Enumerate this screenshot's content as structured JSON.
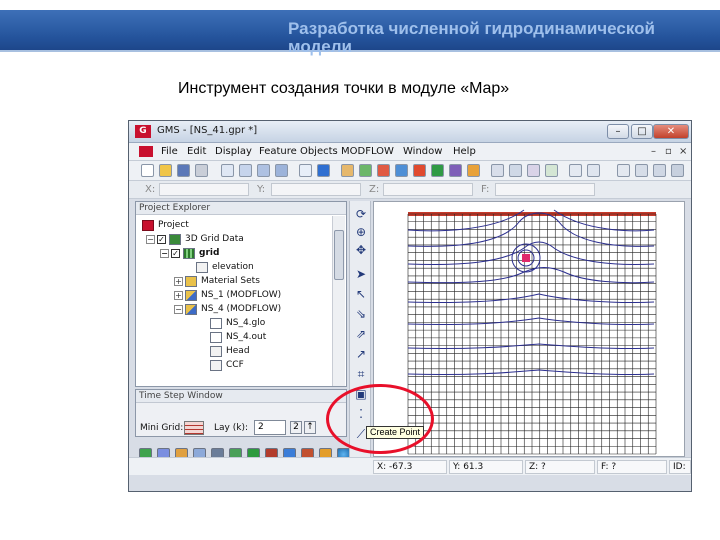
{
  "slide": {
    "title": "Разработка численной гидродинамической модели",
    "subtitle": "Инструмент создания точки в модуле «Map»"
  },
  "window": {
    "title": "GMS - [NS_41.gpr *]",
    "controls": {
      "minimize": "–",
      "maximize": "□",
      "close": "✕"
    }
  },
  "menu": {
    "items": [
      "File",
      "Edit",
      "Display",
      "Feature Objects",
      "MODFLOW",
      "Window",
      "Help"
    ],
    "mdi_controls": {
      "minimize": "–",
      "restore": "▫",
      "close": "×"
    }
  },
  "coords_top": {
    "x_label": "X:",
    "y_label": "Y:",
    "z_label": "Z:",
    "f_label": "F:"
  },
  "explorer": {
    "title": "Project Explorer",
    "tree": [
      {
        "label": "Project",
        "icon": "project-icon"
      },
      {
        "label": "3D Grid Data",
        "icon": "grid-folder-icon",
        "expander": "−",
        "checked": true
      },
      {
        "label": "grid",
        "icon": "grid-icon",
        "expander": "−",
        "checked": true
      },
      {
        "label": "elevation",
        "icon": "dataset-icon"
      },
      {
        "label": "Material Sets",
        "icon": "folder-icon",
        "expander": "+"
      },
      {
        "label": "NS_1 (MODFLOW)",
        "icon": "modflow-icon",
        "expander": "+"
      },
      {
        "label": "NS_4 (MODFLOW)",
        "icon": "modflow-icon",
        "expander": "−"
      },
      {
        "label": "NS_4.glo",
        "icon": "file-icon"
      },
      {
        "label": "NS_4.out",
        "icon": "file-icon"
      },
      {
        "label": "Head",
        "icon": "dataset-icon"
      },
      {
        "label": "CCF",
        "icon": "dataset-icon"
      }
    ]
  },
  "timestep": {
    "title": "Time Step Window",
    "mini_grid_label": "Mini Grid:",
    "layer_label": "Lay (k):",
    "layer_value": "2",
    "spin_down": "2",
    "spin_up": "↑"
  },
  "tooltip": "Create Point",
  "status": {
    "x": "X: -67.3",
    "y": "Y: 61.3",
    "z": "Z: ?",
    "f": "F: ?",
    "id": "ID:"
  },
  "colors": {
    "accent": "#24539b",
    "title_text": "#9fc0ec",
    "highlight": "#e8102a",
    "contour": "#2c2f8f",
    "cell_top": "#c83a2a"
  }
}
